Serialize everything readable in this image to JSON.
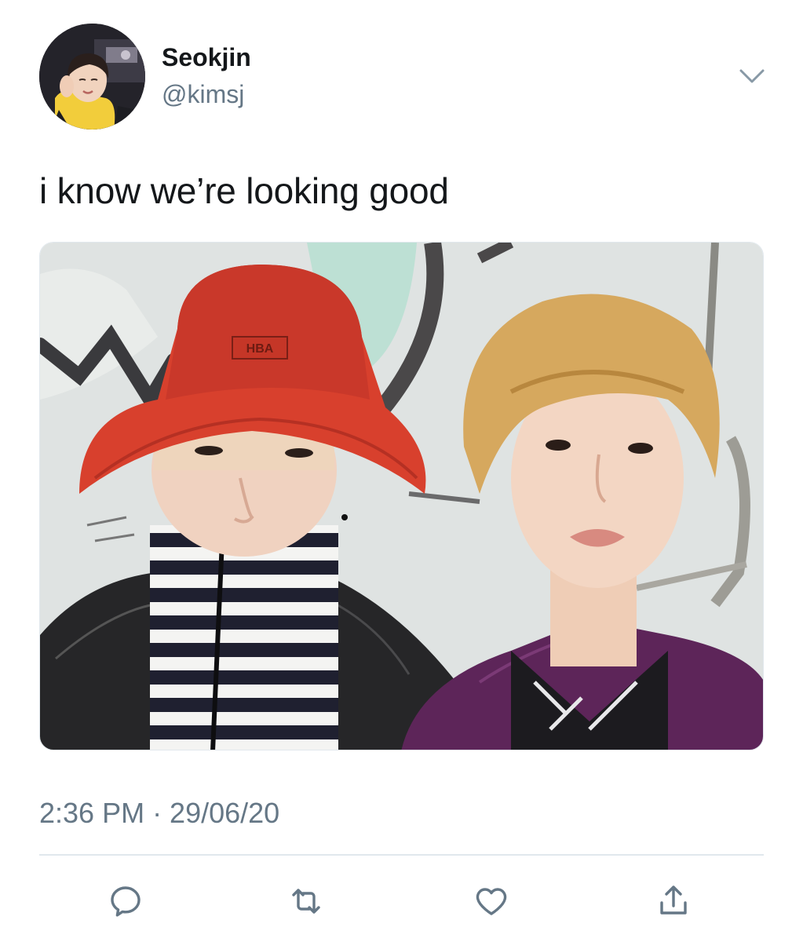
{
  "author": {
    "display_name": "Seokjin",
    "handle": "@kimsj"
  },
  "tweet": {
    "text": "i know we’re looking good",
    "timestamp": "2:36 PM · 29/06/20"
  },
  "media": {
    "hat_label": "HBA"
  },
  "icons": {
    "menu": "chevron-down-icon",
    "reply": "reply-icon",
    "retweet": "retweet-icon",
    "like": "heart-icon",
    "share": "share-icon"
  },
  "colors": {
    "text_primary": "#14171a",
    "text_secondary": "#657786",
    "divider": "#e1e8ed",
    "icon": "#657786"
  }
}
